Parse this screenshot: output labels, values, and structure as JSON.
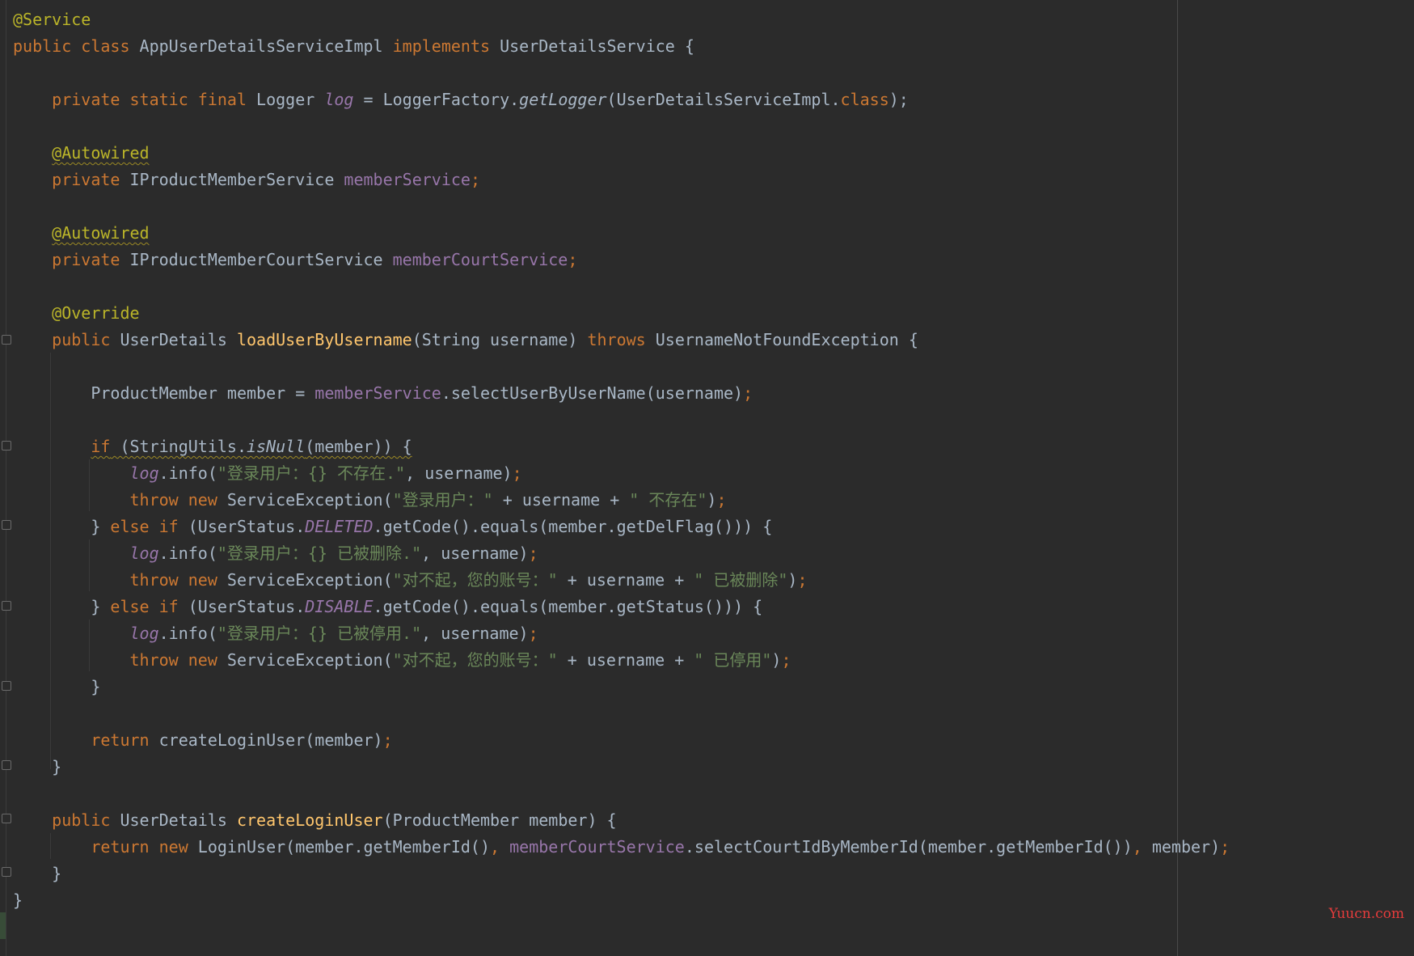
{
  "editor": {
    "lines": [
      [
        {
          "t": "@Service",
          "c": "ann"
        }
      ],
      [
        {
          "t": "public class ",
          "c": "kw"
        },
        {
          "t": "AppUserDetailsServiceImpl "
        },
        {
          "t": "implements ",
          "c": "kw"
        },
        {
          "t": "UserDetailsService {"
        }
      ],
      [],
      [
        {
          "t": "    "
        },
        {
          "t": "private static final ",
          "c": "kw"
        },
        {
          "t": "Logger "
        },
        {
          "t": "log",
          "c": "sfld"
        },
        {
          "t": " = LoggerFactory."
        },
        {
          "t": "getLogger",
          "c": "it"
        },
        {
          "t": "(UserDetailsServiceImpl."
        },
        {
          "t": "class",
          "c": "kw"
        },
        {
          "t": ");"
        }
      ],
      [],
      [
        {
          "t": "    "
        },
        {
          "t": "@Autowired",
          "c": "ann wavy"
        }
      ],
      [
        {
          "t": "    "
        },
        {
          "t": "private ",
          "c": "kw"
        },
        {
          "t": "IProductMemberService "
        },
        {
          "t": "memberService",
          "c": "fld"
        },
        {
          "t": ";",
          "c": "kw"
        }
      ],
      [],
      [
        {
          "t": "    "
        },
        {
          "t": "@Autowired",
          "c": "ann wavy"
        }
      ],
      [
        {
          "t": "    "
        },
        {
          "t": "private ",
          "c": "kw"
        },
        {
          "t": "IProductMemberCourtService "
        },
        {
          "t": "memberCourtService",
          "c": "fld"
        },
        {
          "t": ";",
          "c": "kw"
        }
      ],
      [],
      [
        {
          "t": "    "
        },
        {
          "t": "@Override",
          "c": "ann"
        }
      ],
      [
        {
          "t": "    "
        },
        {
          "t": "public ",
          "c": "kw"
        },
        {
          "t": "UserDetails "
        },
        {
          "t": "loadUserByUsername",
          "c": "mth"
        },
        {
          "t": "(String username) "
        },
        {
          "t": "throws ",
          "c": "kw"
        },
        {
          "t": "UsernameNotFoundException {"
        }
      ],
      [],
      [
        {
          "t": "        ProductMember member = "
        },
        {
          "t": "memberService",
          "c": "fld"
        },
        {
          "t": ".selectUserByUserName(username)"
        },
        {
          "t": ";",
          "c": "kw"
        }
      ],
      [],
      [
        {
          "t": "        "
        },
        {
          "t": "if",
          "c": "kw wavy"
        },
        {
          "t": " (StringUtils.",
          "c": "wavy"
        },
        {
          "t": "isNull",
          "c": "it wavy"
        },
        {
          "t": "(member)) {",
          "c": "wavy"
        }
      ],
      [
        {
          "t": "            "
        },
        {
          "t": "log",
          "c": "sfld"
        },
        {
          "t": ".info("
        },
        {
          "t": "\"登录用户：{} 不存在.\"",
          "c": "str"
        },
        {
          "t": ", username)"
        },
        {
          "t": ";",
          "c": "kw"
        }
      ],
      [
        {
          "t": "            "
        },
        {
          "t": "throw new ",
          "c": "kw"
        },
        {
          "t": "ServiceException("
        },
        {
          "t": "\"登录用户：\"",
          "c": "str"
        },
        {
          "t": " + username + "
        },
        {
          "t": "\" 不存在\"",
          "c": "str"
        },
        {
          "t": ")"
        },
        {
          "t": ";",
          "c": "kw"
        }
      ],
      [
        {
          "t": "        } "
        },
        {
          "t": "else if ",
          "c": "kw"
        },
        {
          "t": "(UserStatus."
        },
        {
          "t": "DELETED",
          "c": "sfld"
        },
        {
          "t": ".getCode().equals(member.getDelFlag())) {"
        }
      ],
      [
        {
          "t": "            "
        },
        {
          "t": "log",
          "c": "sfld"
        },
        {
          "t": ".info("
        },
        {
          "t": "\"登录用户：{} 已被删除.\"",
          "c": "str"
        },
        {
          "t": ", username)"
        },
        {
          "t": ";",
          "c": "kw"
        }
      ],
      [
        {
          "t": "            "
        },
        {
          "t": "throw new ",
          "c": "kw"
        },
        {
          "t": "ServiceException("
        },
        {
          "t": "\"对不起，您的账号：\"",
          "c": "str"
        },
        {
          "t": " + username + "
        },
        {
          "t": "\" 已被删除\"",
          "c": "str"
        },
        {
          "t": ")"
        },
        {
          "t": ";",
          "c": "kw"
        }
      ],
      [
        {
          "t": "        } "
        },
        {
          "t": "else if ",
          "c": "kw"
        },
        {
          "t": "(UserStatus."
        },
        {
          "t": "DISABLE",
          "c": "sfld"
        },
        {
          "t": ".getCode().equals(member.getStatus())) {"
        }
      ],
      [
        {
          "t": "            "
        },
        {
          "t": "log",
          "c": "sfld"
        },
        {
          "t": ".info("
        },
        {
          "t": "\"登录用户：{} 已被停用.\"",
          "c": "str"
        },
        {
          "t": ", username)"
        },
        {
          "t": ";",
          "c": "kw"
        }
      ],
      [
        {
          "t": "            "
        },
        {
          "t": "throw new ",
          "c": "kw"
        },
        {
          "t": "ServiceException("
        },
        {
          "t": "\"对不起，您的账号：\"",
          "c": "str"
        },
        {
          "t": " + username + "
        },
        {
          "t": "\" 已停用\"",
          "c": "str"
        },
        {
          "t": ")"
        },
        {
          "t": ";",
          "c": "kw"
        }
      ],
      [
        {
          "t": "        }"
        }
      ],
      [],
      [
        {
          "t": "        "
        },
        {
          "t": "return ",
          "c": "kw"
        },
        {
          "t": "createLoginUser(member)"
        },
        {
          "t": ";",
          "c": "kw"
        }
      ],
      [
        {
          "t": "    }"
        }
      ],
      [],
      [
        {
          "t": "    "
        },
        {
          "t": "public ",
          "c": "kw"
        },
        {
          "t": "UserDetails "
        },
        {
          "t": "createLoginUser",
          "c": "mth"
        },
        {
          "t": "(ProductMember member) {"
        }
      ],
      [
        {
          "t": "        "
        },
        {
          "t": "return new ",
          "c": "kw"
        },
        {
          "t": "LoginUser(member.getMemberId()"
        },
        {
          "t": ", ",
          "c": "kw"
        },
        {
          "t": "memberCourtService",
          "c": "fld"
        },
        {
          "t": ".selectCourtIdByMemberId(member.getMemberId())"
        },
        {
          "t": ", ",
          "c": "kw"
        },
        {
          "t": "member)"
        },
        {
          "t": ";",
          "c": "kw"
        }
      ],
      [
        {
          "t": "    }"
        }
      ],
      [
        {
          "t": "}"
        }
      ]
    ]
  },
  "watermark": "Yuucn.com",
  "colors": {
    "background": "#2b2b2b",
    "default_text": "#a9b7c6",
    "keyword": "#cc7832",
    "annotation": "#bbb529",
    "field": "#9876aa",
    "method_declaration": "#ffc66d",
    "string": "#6a8759",
    "watermark": "#e63c3c"
  }
}
